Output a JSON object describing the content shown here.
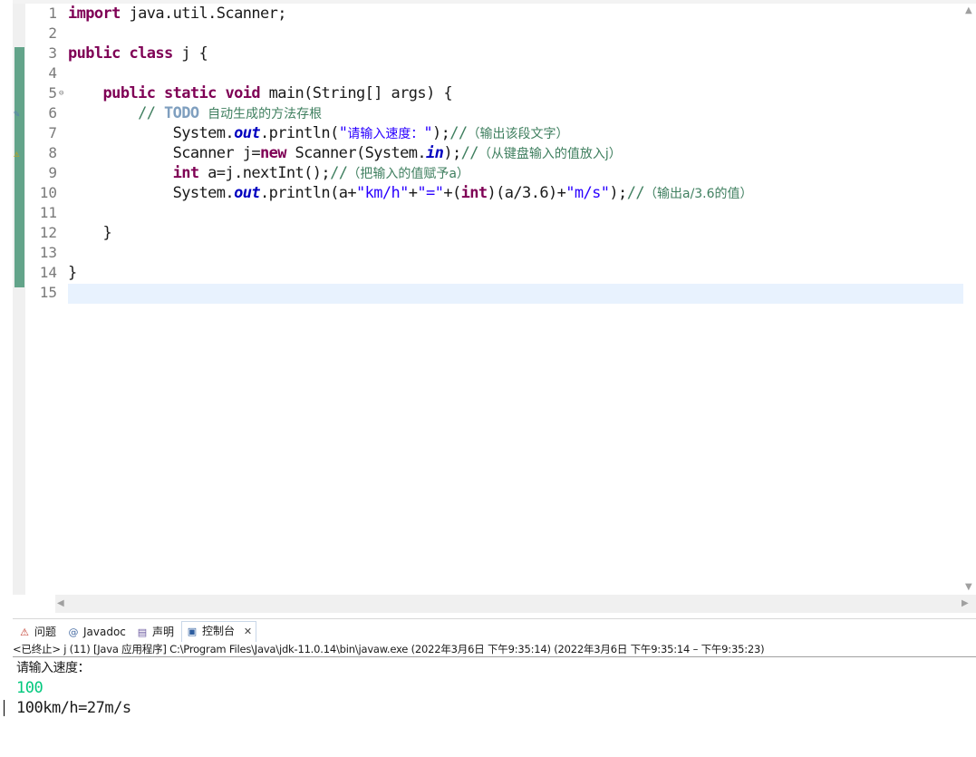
{
  "editor": {
    "line_numbers": [
      "1",
      "2",
      "3",
      "4",
      "5",
      "6",
      "7",
      "8",
      "9",
      "10",
      "11",
      "12",
      "13",
      "14",
      "15"
    ],
    "fold_marker": "⊖",
    "lines": [
      [
        {
          "t": "import",
          "c": "kw"
        },
        {
          "t": " java.util.Scanner;"
        }
      ],
      [],
      [
        {
          "t": "public",
          "c": "kw"
        },
        {
          "t": " "
        },
        {
          "t": "class",
          "c": "kw"
        },
        {
          "t": " j {"
        }
      ],
      [],
      [
        {
          "t": "    "
        },
        {
          "t": "public",
          "c": "kw"
        },
        {
          "t": " "
        },
        {
          "t": "static",
          "c": "kw"
        },
        {
          "t": " "
        },
        {
          "t": "void",
          "c": "kw"
        },
        {
          "t": " main(String[] args) {"
        }
      ],
      [
        {
          "t": "        // ",
          "c": "cmt"
        },
        {
          "t": "TODO",
          "c": "todo"
        },
        {
          "t": " "
        },
        {
          "t": "自动生成的方法存根",
          "c": "cmt cjk"
        }
      ],
      [
        {
          "t": "            System."
        },
        {
          "t": "out",
          "c": "fld"
        },
        {
          "t": ".println("
        },
        {
          "t": "\"",
          "c": "str"
        },
        {
          "t": "请输入速度：",
          "c": "str cjk"
        },
        {
          "t": "\"",
          "c": "str"
        },
        {
          "t": ");"
        },
        {
          "t": "//",
          "c": "cmt"
        },
        {
          "t": "（输出该段文字）",
          "c": "cmt cjk"
        }
      ],
      [
        {
          "t": "            Scanner j="
        },
        {
          "t": "new",
          "c": "kw"
        },
        {
          "t": " Scanner(System."
        },
        {
          "t": "in",
          "c": "fld"
        },
        {
          "t": ");"
        },
        {
          "t": "//",
          "c": "cmt"
        },
        {
          "t": "（从键盘输入的值放入j）",
          "c": "cmt cjk"
        }
      ],
      [
        {
          "t": "            "
        },
        {
          "t": "int",
          "c": "kw"
        },
        {
          "t": " a=j.nextInt();"
        },
        {
          "t": "//",
          "c": "cmt"
        },
        {
          "t": "（把输入的值赋予a）",
          "c": "cmt cjk"
        }
      ],
      [
        {
          "t": "            System."
        },
        {
          "t": "out",
          "c": "fld"
        },
        {
          "t": ".println(a+"
        },
        {
          "t": "\"km/h\"",
          "c": "str"
        },
        {
          "t": "+"
        },
        {
          "t": "\"=\"",
          "c": "str"
        },
        {
          "t": "+("
        },
        {
          "t": "int",
          "c": "kw"
        },
        {
          "t": ")(a/3.6)+"
        },
        {
          "t": "\"m/s\"",
          "c": "str"
        },
        {
          "t": ");"
        },
        {
          "t": "//",
          "c": "cmt"
        },
        {
          "t": "（输出a/3.6的值）",
          "c": "cmt cjk"
        }
      ],
      [],
      [
        {
          "t": "    }"
        }
      ],
      [],
      [
        {
          "t": "}"
        }
      ],
      []
    ]
  },
  "console": {
    "tabs": [
      {
        "label": "问题",
        "icon": "problems-icon",
        "icon_glyph": "⚠"
      },
      {
        "label": "Javadoc",
        "icon": "javadoc-icon",
        "icon_glyph": "@"
      },
      {
        "label": "声明",
        "icon": "declaration-icon",
        "icon_glyph": "▤"
      },
      {
        "label": "控制台",
        "icon": "console-icon",
        "icon_glyph": "▣"
      }
    ],
    "close_glyph": "✕",
    "status": "<已终止> j (11)  [Java 应用程序] C:\\Program Files\\Java\\jdk-11.0.14\\bin\\javaw.exe  (2022年3月6日 下午9:35:14)  (2022年3月6日 下午9:35:14 – 下午9:35:23)",
    "output": {
      "prompt": "请输入速度：",
      "input": "100",
      "result": "100km/h=27m/s"
    }
  },
  "colors": {
    "keyword": "#7f0055",
    "string": "#2a00ff",
    "comment": "#3f7f5f",
    "field": "#0000c0",
    "console_input": "#00c87d",
    "current_line": "#e8f2fe"
  }
}
